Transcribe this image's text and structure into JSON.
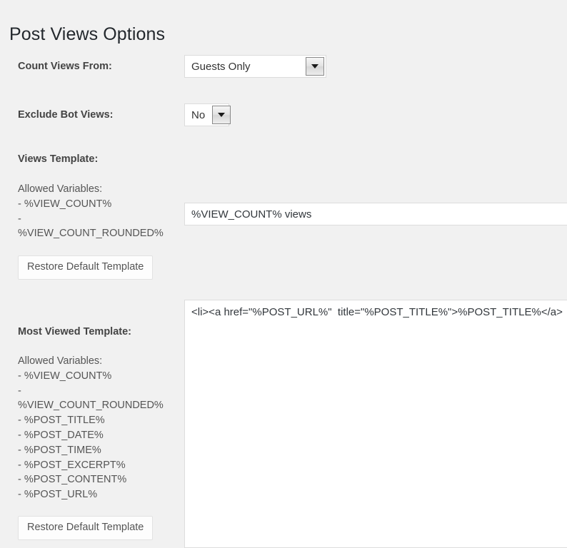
{
  "page": {
    "title": "Post Views Options"
  },
  "fields": {
    "count_views_from": {
      "label": "Count Views From:",
      "value": "Guests Only",
      "arrow_icon": "chevron-down-icon"
    },
    "exclude_bot_views": {
      "label": "Exclude Bot Views:",
      "value": "No",
      "arrow_icon": "chevron-down-icon"
    },
    "views_template": {
      "label": "Views Template:",
      "allowed_variables_heading": "Allowed Variables:",
      "allowed_variables": [
        "- %VIEW_COUNT%",
        "-",
        "%VIEW_COUNT_ROUNDED%"
      ],
      "value": "%VIEW_COUNT% views",
      "restore_label": "Restore Default Template"
    },
    "most_viewed_template": {
      "label": "Most Viewed Template:",
      "allowed_variables_heading": "Allowed Variables:",
      "allowed_variables": [
        "- %VIEW_COUNT%",
        "-",
        "%VIEW_COUNT_ROUNDED%",
        "- %POST_TITLE%",
        "- %POST_DATE%",
        "- %POST_TIME%",
        "- %POST_EXCERPT%",
        "- %POST_CONTENT%",
        "- %POST_URL%"
      ],
      "value": "<li><a href=\"%POST_URL%\"  title=\"%POST_TITLE%\">%POST_TITLE%</a>",
      "restore_label": "Restore Default Template"
    }
  },
  "colors": {
    "page_background": "#f1f1f1",
    "title_text": "#23282d",
    "label_text": "#444444",
    "helper_text": "#555555",
    "input_background": "#ffffff",
    "input_border": "#dddddd"
  }
}
